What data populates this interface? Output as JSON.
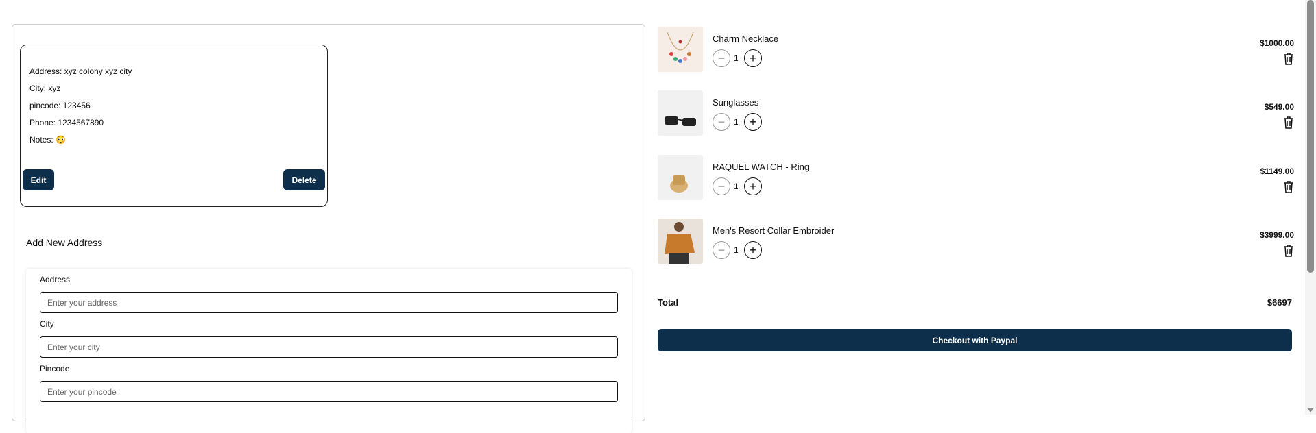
{
  "address_card": {
    "address": "Address: xyz colony xyz city",
    "city": "City: xyz",
    "pincode": "pincode: 123456",
    "phone": "Phone: 1234567890",
    "notes": "Notes: 😳",
    "edit_label": "Edit",
    "delete_label": "Delete"
  },
  "form": {
    "title": "Add New Address",
    "address_label": "Address",
    "address_placeholder": "Enter your address",
    "city_label": "City",
    "city_placeholder": "Enter your city",
    "pincode_label": "Pincode",
    "pincode_placeholder": "Enter your pincode"
  },
  "cart": {
    "items": [
      {
        "name": "Charm Necklace",
        "qty": "1",
        "price": "$1000.00",
        "icon": "necklace-image"
      },
      {
        "name": "Sunglasses",
        "qty": "1",
        "price": "$549.00",
        "icon": "sunglasses-image"
      },
      {
        "name": "RAQUEL WATCH - Ring",
        "qty": "1",
        "price": "$1149.00",
        "icon": "ring-image"
      },
      {
        "name": "Men's Resort Collar Embroider",
        "qty": "1",
        "price": "$3999.00",
        "icon": "shirt-image"
      }
    ],
    "total_label": "Total",
    "total_value": "$6697",
    "checkout_label": "Checkout with Paypal"
  },
  "colors": {
    "primary": "#0d2f4c"
  }
}
